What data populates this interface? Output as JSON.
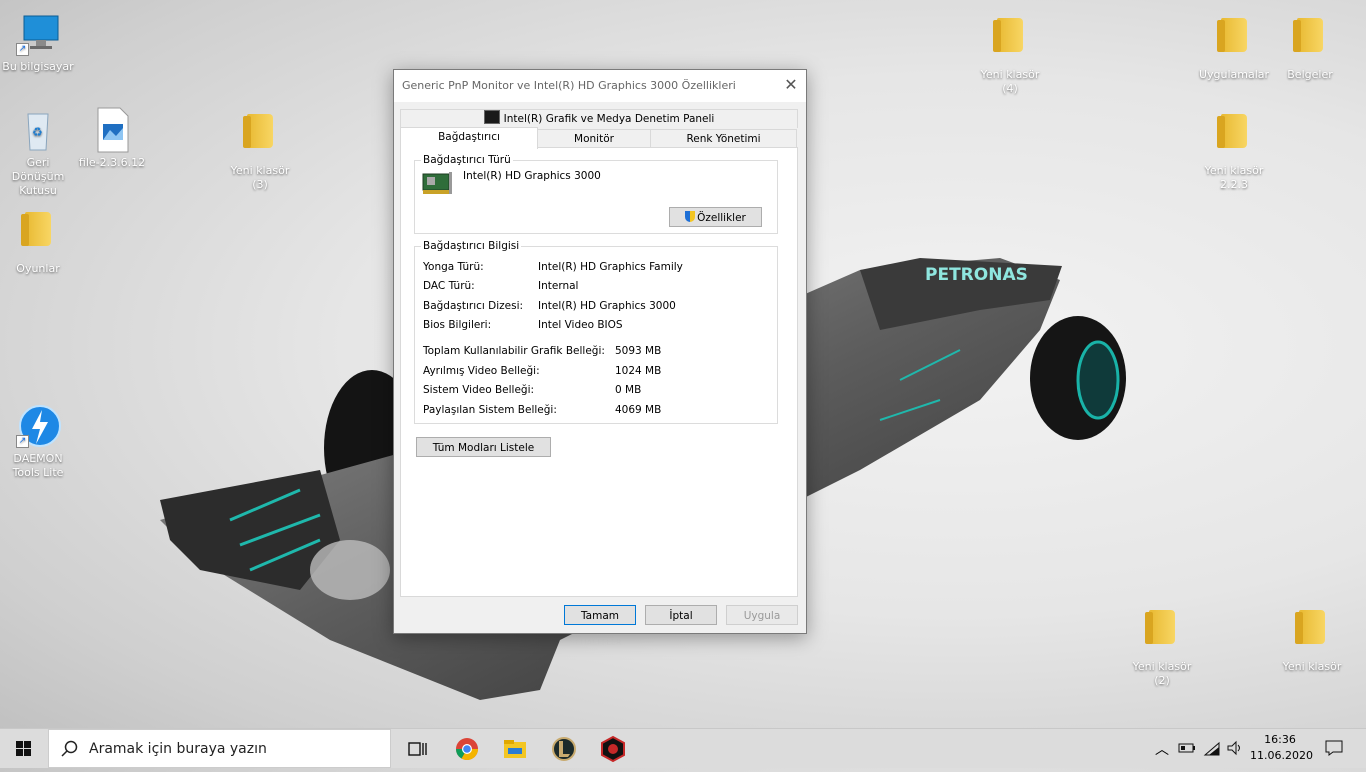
{
  "desktop": {
    "left_icons": [
      {
        "label": "Bu bilgisayar",
        "kind": "pc"
      },
      {
        "label": "Geri Dönüşüm Kutusu",
        "kind": "recycle"
      },
      {
        "label": "file-2.3.6.12",
        "kind": "image"
      },
      {
        "label": "Yeni klasör (3)",
        "kind": "folder"
      },
      {
        "label": "Oyunlar",
        "kind": "folder"
      },
      {
        "label": "DAEMON Tools Lite",
        "kind": "daemon"
      }
    ],
    "right_icons": [
      {
        "label": "Yeni klasör (4)",
        "kind": "folder"
      },
      {
        "label": "Uygulamalar",
        "kind": "folder"
      },
      {
        "label": "Belgeler",
        "kind": "folder"
      },
      {
        "label": "Yeni klasör 2.2.3",
        "kind": "folder"
      },
      {
        "label": "Yeni klasör (2)",
        "kind": "folder"
      },
      {
        "label": "Yeni klasör",
        "kind": "folder"
      }
    ]
  },
  "dialog": {
    "title": "Generic PnP Monitor ve Intel(R) HD Graphics 3000 Özellikleri",
    "tabs_top": [
      "Intel(R) Grafik ve Medya Denetim Paneli"
    ],
    "tabs": [
      "Bağdaştırıcı",
      "Monitör",
      "Renk Yönetimi"
    ],
    "active_tab": "Bağdaştırıcı",
    "adapter_type_group": {
      "legend": "Bağdaştırıcı Türü",
      "name": "Intel(R) HD Graphics 3000",
      "properties_button": "Özellikler"
    },
    "adapter_info_group": {
      "legend": "Bağdaştırıcı Bilgisi",
      "rows": [
        {
          "label": "Yonga Türü:",
          "value": "Intel(R) HD Graphics Family"
        },
        {
          "label": "DAC Türü:",
          "value": "Internal"
        },
        {
          "label": "Bağdaştırıcı Dizesi:",
          "value": "Intel(R) HD Graphics 3000"
        },
        {
          "label": "Bios Bilgileri:",
          "value": "Intel Video BIOS"
        }
      ],
      "memory_rows": [
        {
          "label": "Toplam Kullanılabilir Grafik Belleği:",
          "value": "5093 MB"
        },
        {
          "label": "Ayrılmış Video Belleği:",
          "value": "1024 MB"
        },
        {
          "label": "Sistem Video Belleği:",
          "value": "0 MB"
        },
        {
          "label": "Paylaşılan Sistem Belleği:",
          "value": "4069 MB"
        }
      ]
    },
    "list_modes_button": "Tüm Modları Listele",
    "ok_button": "Tamam",
    "cancel_button": "İptal",
    "apply_button": "Uygula"
  },
  "taskbar": {
    "search_placeholder": "Aramak için buraya yazın",
    "time": "16:36",
    "date": "11.06.2020"
  }
}
